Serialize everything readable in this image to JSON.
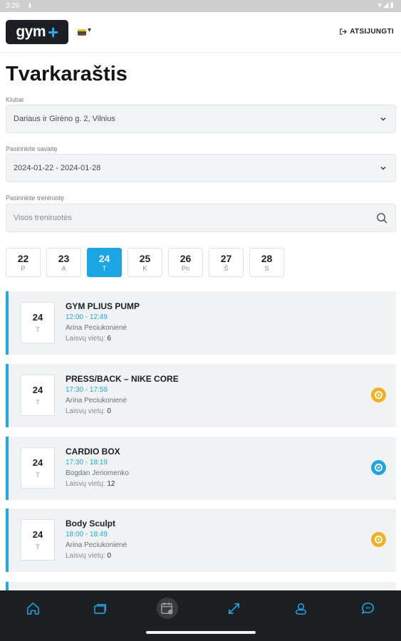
{
  "status_bar": {
    "time": "3:29",
    "icons": [
      "notification-icon",
      "wifi-icon",
      "signal-icon",
      "battery-icon"
    ]
  },
  "header": {
    "logo_text": "gym",
    "logo_plus": "+",
    "language_flag": "lithuania-flag",
    "logout_label": "ATSIJUNGTI"
  },
  "page_title": "Tvarkaraštis",
  "filters": {
    "club_label": "Klubai",
    "club_value": "Dariaus ir Girėno g. 2, Vilnius",
    "week_label": "Pasirinkite savaitę",
    "week_value": "2024-01-22 - 2024-01-28",
    "workout_label": "Pasirinkite treniruotę",
    "workout_placeholder": "Visos treniruotės"
  },
  "days": [
    {
      "num": "22",
      "wd": "P",
      "active": false
    },
    {
      "num": "23",
      "wd": "A",
      "active": false
    },
    {
      "num": "24",
      "wd": "T",
      "active": true
    },
    {
      "num": "25",
      "wd": "K",
      "active": false
    },
    {
      "num": "26",
      "wd": "Pn",
      "active": false
    },
    {
      "num": "27",
      "wd": "Š",
      "active": false
    },
    {
      "num": "28",
      "wd": "S",
      "active": false
    }
  ],
  "sessions": [
    {
      "day": "24",
      "wd": "T",
      "title": "GYM PLIUS PUMP",
      "time": "12:00 - 12:49",
      "trainer": "Arina Peciukonienė",
      "spots_label": "Laisvų vietų:",
      "spots": "6",
      "status": "none"
    },
    {
      "day": "24",
      "wd": "T",
      "title": "PRESS/BACK – NIKE CORE",
      "time": "17:30 - 17:59",
      "trainer": "Arina Peciukonienė",
      "spots_label": "Laisvų vietų:",
      "spots": "0",
      "status": "full"
    },
    {
      "day": "24",
      "wd": "T",
      "title": "CARDIO BOX",
      "time": "17:30 - 18:19",
      "trainer": "Bogdan Jeriomenko",
      "spots_label": "Laisvų vietų:",
      "spots": "12",
      "status": "available"
    },
    {
      "day": "24",
      "wd": "T",
      "title": "Body Sculpt",
      "time": "18:00 - 18:49",
      "trainer": "Arina Peciukonienė",
      "spots_label": "Laisvų vietų:",
      "spots": "0",
      "status": "full"
    }
  ],
  "colors": {
    "accent": "#1aa6e4",
    "full": "#f2b01e",
    "nav_bg": "#1e1f23"
  },
  "bottom_nav": [
    {
      "name": "home-icon",
      "active": false
    },
    {
      "name": "cards-icon",
      "active": false
    },
    {
      "name": "schedule-icon",
      "active": true
    },
    {
      "name": "expand-icon",
      "active": false
    },
    {
      "name": "profile-icon",
      "active": false
    },
    {
      "name": "chat-icon",
      "active": false
    }
  ]
}
